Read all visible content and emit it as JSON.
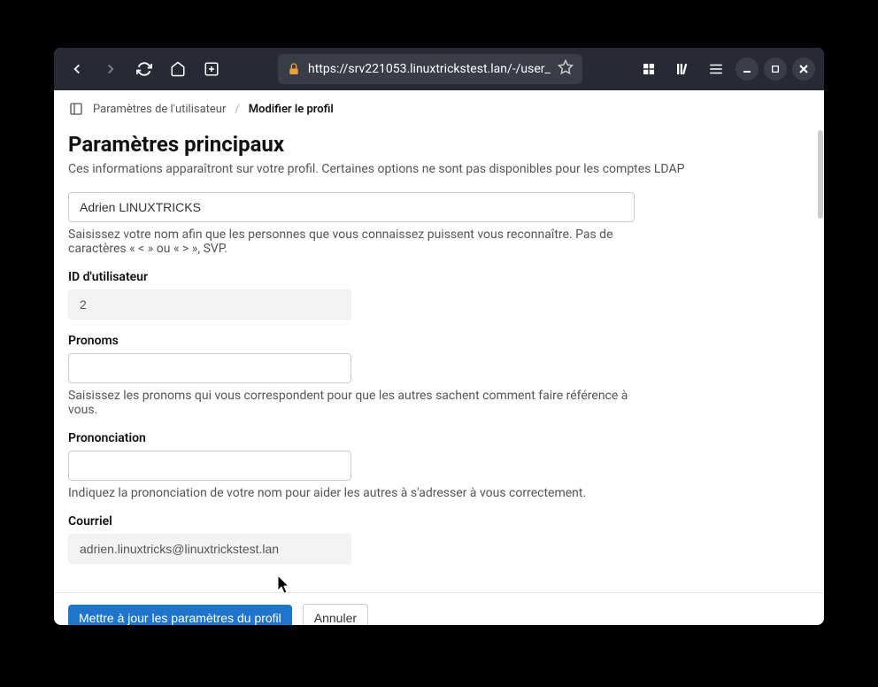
{
  "browser": {
    "url": "https://srv221053.linuxtrickstest.lan/-/user_"
  },
  "breadcrumb": {
    "parent": "Paramètres de l'utilisateur",
    "separator": "/",
    "current": "Modifier le profil"
  },
  "page": {
    "title": "Paramètres principaux",
    "description": "Ces informations apparaîtront sur votre profil. Certaines options ne sont pas disponibles pour les comptes LDAP"
  },
  "form": {
    "name": {
      "value": "Adrien LINUXTRICKS",
      "help": "Saisissez votre nom afin que les personnes que vous connaissez puissent vous reconnaître. Pas de caractères « < » ou « > », SVP."
    },
    "userid": {
      "label": "ID d'utilisateur",
      "value": "2"
    },
    "pronouns": {
      "label": "Pronoms",
      "value": "",
      "help": "Saisissez les pronoms qui vous correspondent pour que les autres sachent comment faire référence à vous."
    },
    "pronunciation": {
      "label": "Prononciation",
      "value": "",
      "help": "Indiquez la prononciation de votre nom pour aider les autres à s'adresser à vous correctement."
    },
    "email": {
      "label": "Courriel",
      "value": "adrien.linuxtricks@linuxtrickstest.lan"
    }
  },
  "buttons": {
    "submit": "Mettre à jour les paramètres du profil",
    "cancel": "Annuler"
  }
}
